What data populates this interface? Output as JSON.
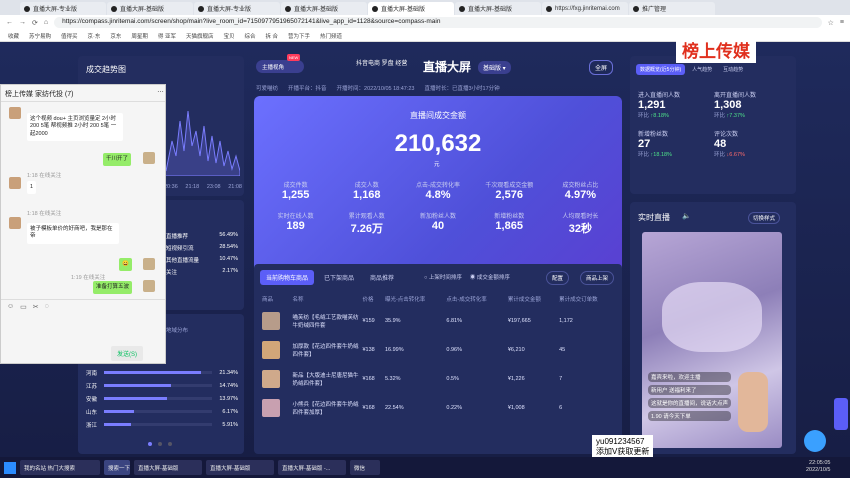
{
  "browser": {
    "tabs": [
      "直播大屏-专业版",
      "直播大屏-基础版",
      "直播大屏-专业版",
      "直播大屏-基础版",
      "直播大屏-基础版",
      "直播大屏-基础版",
      "https://fxg.jinritemai.com",
      "推广管理"
    ],
    "url": "https://compass.jinritemai.com/screen/shop/main?live_room_id=7150977951965072141&live_app_id=1128&source=compass-main",
    "bookmarks": [
      "收藏",
      "苏宁易购",
      "值得买",
      "京·东",
      "京东",
      "周星期",
      "得 亚军",
      "天猫旗舰店",
      "宝贝",
      "综合",
      "拆 合",
      "营为下手",
      "热门频道"
    ]
  },
  "watermark": "榜上传媒",
  "header": {
    "logo": "抖音电商 罗盘",
    "logo_sub": "经营",
    "title": "直播大屏",
    "edition": "基础版",
    "badge": "主播视角",
    "badge_tag": "NEW",
    "fullscreen": "全屏",
    "shop": "可爱喵纺",
    "platform": "开播平台：抖音",
    "start_time": "开播时间：2022/10/05 18:47:23",
    "duration": "直播时长：已直播3小时17分钟"
  },
  "gmv": {
    "label": "直播间成交金额",
    "value": "210,632",
    "unit": "元"
  },
  "kpis": [
    {
      "label": "成交件数",
      "value": "1,255"
    },
    {
      "label": "成交人数",
      "value": "1,168"
    },
    {
      "label": "点击-成交转化率",
      "value": "4.8%"
    },
    {
      "label": "千次观看成交金额",
      "value": "2,576"
    },
    {
      "label": "成交粉丝占比",
      "value": "4.97%"
    },
    {
      "label": "实时在线人数",
      "value": "189"
    },
    {
      "label": "累计观看人数",
      "value": "7.26万"
    },
    {
      "label": "新加粉丝人数",
      "value": "40"
    },
    {
      "label": "新增粉丝数",
      "value": "1,865"
    },
    {
      "label": "人均观看时长",
      "value": "32秒"
    }
  ],
  "left": {
    "trend_title": "成交趋势图",
    "times": [
      "20:36",
      "21:18",
      "23:08",
      "21:08"
    ],
    "channels": [
      {
        "label": "直播推荐",
        "value": "56.49%"
      },
      {
        "label": "短视频引流",
        "value": "28.54%"
      },
      {
        "label": "其他直播流量",
        "value": "10.47%"
      },
      {
        "label": "关注",
        "value": "2.17%"
      }
    ],
    "region_title": "地域分布",
    "regions": [
      {
        "label": "河南",
        "value": "21.34%",
        "pct": 0.9
      },
      {
        "label": "江苏",
        "value": "14.74%",
        "pct": 0.62
      },
      {
        "label": "安徽",
        "value": "13.97%",
        "pct": 0.58
      },
      {
        "label": "山东",
        "value": "6.17%",
        "pct": 0.28
      },
      {
        "label": "浙江",
        "value": "5.91%",
        "pct": 0.25
      }
    ]
  },
  "products": {
    "tabs": [
      "当前购物车商品",
      "已下架商品",
      "商品推荐"
    ],
    "radios": [
      "上架时间排序",
      "成交金额排序"
    ],
    "buttons": [
      "配置",
      "商品上架"
    ],
    "headers": [
      "商品",
      "名称",
      "价格",
      "曝光-点击转化率",
      "点击-成交转化率",
      "累计成交金额",
      "累计成交订单数"
    ],
    "rows": [
      {
        "name": "喵芙纺【毛绒工艺款喵芙纺牛奶绒四件套",
        "price": "¥159",
        "ctr": "35.9%",
        "cvr": "6.81%",
        "gmv": "¥197,665",
        "orders": "1,172"
      },
      {
        "name": "加厚款【花边四件套牛奶绒四件套】",
        "price": "¥138",
        "ctr": "16.99%",
        "cvr": "0.96%",
        "gmv": "¥6,210",
        "orders": "45"
      },
      {
        "name": "新品【大版迪士尼唐尼猫牛奶绒四件套】",
        "price": "¥168",
        "ctr": "5.32%",
        "cvr": "0.5%",
        "gmv": "¥1,226",
        "orders": "7"
      },
      {
        "name": "小熊兵【花边四件套牛奶绒四件套加厚】",
        "price": "¥168",
        "ctr": "22.54%",
        "cvr": "0.22%",
        "gmv": "¥1,008",
        "orders": "6"
      }
    ]
  },
  "right": {
    "tabs": [
      "数据概览(近5分钟)",
      "人气趋势",
      "互动趋势"
    ],
    "metrics": [
      {
        "label": "进入直播间人数",
        "value": "1,291",
        "ratio": "环比",
        "delta": "8.18%",
        "dir": "up"
      },
      {
        "label": "离开直播间人数",
        "value": "1,308",
        "ratio": "环比",
        "delta": "7.37%",
        "dir": "up"
      },
      {
        "label": "新增粉丝数",
        "value": "27",
        "ratio": "环比",
        "delta": "18.18%",
        "dir": "up"
      },
      {
        "label": "评论次数",
        "value": "48",
        "ratio": "环比",
        "delta": "6.67%",
        "dir": "down"
      }
    ],
    "live_title": "实时直播",
    "switch_label": "切换样式",
    "comments": [
      "嘉宾来啦，欢迎主播",
      "新用户 送福利来了",
      "这就是你的直播间，说话大点声",
      "1.90 请今天下单"
    ]
  },
  "chat": {
    "title": "榜上传媒 家纺代投 (7)",
    "messages": [
      {
        "side": "left",
        "text": "这个视频 dou+ 主页浏览量定 2小时 200 5笔 帮视频推 2小时 200 5笔 一起2000"
      },
      {
        "side": "right",
        "text": "千川开了"
      },
      {
        "side": "left",
        "text": "1"
      },
      {
        "side": "left",
        "text": "被子模板单价的好商吧，我是那在帝"
      },
      {
        "side": "right",
        "text": "😀"
      },
      {
        "side": "right",
        "text": "准备打算五波"
      }
    ],
    "times": [
      "1:18 在线关注",
      "1:18 在线关注",
      "1:19 在线关注"
    ],
    "send": "发送(S)"
  },
  "contact": {
    "line1": "yu091234567",
    "line2": "添加V获取更新"
  },
  "taskbar": {
    "items": [
      "我的名站 热门大搜索",
      "搜索一下",
      "直播大屏-基础版",
      "直播大屏-基础版",
      "直播大屏-基础版 -...",
      "微信"
    ],
    "time": "22:05:05",
    "date": "2022/10/5"
  },
  "colors": {
    "accent": "#5b5ef7",
    "panel": "#232d5f",
    "chart": "#7a7dff",
    "gmv_card": "#5f63f2"
  }
}
